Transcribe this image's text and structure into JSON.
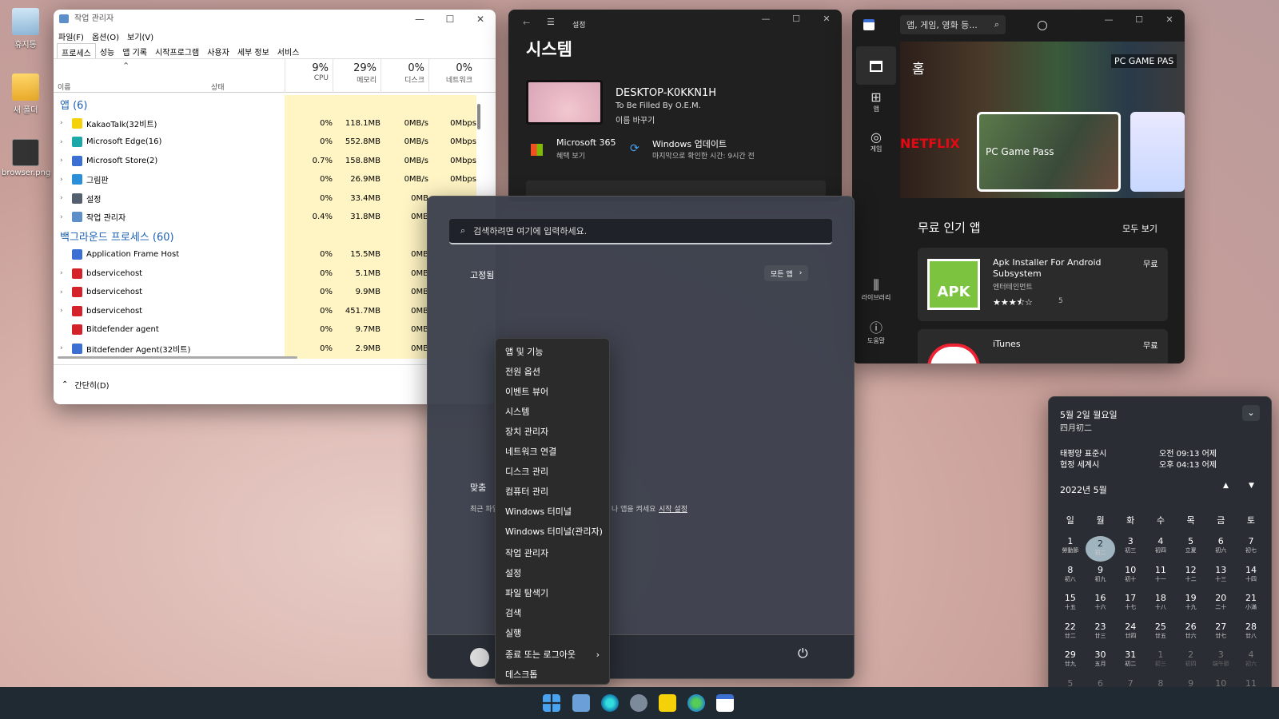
{
  "desktop": {
    "icons": [
      {
        "label": "휴지통"
      },
      {
        "label": "새 폴더"
      },
      {
        "label": "browser.png"
      }
    ]
  },
  "taskmgr": {
    "title": "작업 관리자",
    "menu": [
      "파일(F)",
      "옵션(O)",
      "보기(V)"
    ],
    "tabs": [
      "프로세스",
      "성능",
      "앱 기록",
      "시작프로그램",
      "사용자",
      "세부 정보",
      "서비스"
    ],
    "cols": {
      "name": "이름",
      "status": "상태",
      "cpu": {
        "pct": "9%",
        "label": "CPU"
      },
      "mem": {
        "pct": "29%",
        "label": "메모리"
      },
      "disk": {
        "pct": "0%",
        "label": "디스크"
      },
      "net": {
        "pct": "0%",
        "label": "네트워크"
      }
    },
    "apps_group": "앱 (6)",
    "bg_group": "백그라운드 프로세스 (60)",
    "apps": [
      {
        "name": "KakaoTalk(32비트)",
        "cpu": "0%",
        "mem": "118.1MB",
        "disk": "0MB/s",
        "net": "0Mbps",
        "color": "#f5d10a"
      },
      {
        "name": "Microsoft Edge(16)",
        "cpu": "0%",
        "mem": "552.8MB",
        "disk": "0MB/s",
        "net": "0Mbps",
        "color": "#1ca7a8"
      },
      {
        "name": "Microsoft Store(2)",
        "cpu": "0.7%",
        "mem": "158.8MB",
        "disk": "0MB/s",
        "net": "0Mbps",
        "color": "#3b6fd1"
      },
      {
        "name": "그림판",
        "cpu": "0%",
        "mem": "26.9MB",
        "disk": "0MB/s",
        "net": "0Mbps",
        "color": "#2a8fd8"
      },
      {
        "name": "설정",
        "cpu": "0%",
        "mem": "33.4MB",
        "disk": "0MB",
        "net": "",
        "color": "#55606e"
      },
      {
        "name": "작업 관리자",
        "cpu": "0.4%",
        "mem": "31.8MB",
        "disk": "0MB",
        "net": "",
        "color": "#5d8fc8"
      }
    ],
    "bg": [
      {
        "name": "Application Frame Host",
        "cpu": "0%",
        "mem": "15.5MB",
        "disk": "0MB",
        "color": "#3b6fd1",
        "arrow": ""
      },
      {
        "name": "bdservicehost",
        "cpu": "0%",
        "mem": "5.1MB",
        "disk": "0MB",
        "color": "#d3222a",
        "arrow": "›"
      },
      {
        "name": "bdservicehost",
        "cpu": "0%",
        "mem": "9.9MB",
        "disk": "0MB",
        "color": "#d3222a",
        "arrow": "›"
      },
      {
        "name": "bdservicehost",
        "cpu": "0%",
        "mem": "451.7MB",
        "disk": "0MB",
        "color": "#d3222a",
        "arrow": "›"
      },
      {
        "name": "Bitdefender agent",
        "cpu": "0%",
        "mem": "9.7MB",
        "disk": "0MB",
        "color": "#d3222a",
        "arrow": ""
      },
      {
        "name": "Bitdefender Agent(32비트)",
        "cpu": "0%",
        "mem": "2.9MB",
        "disk": "0MB",
        "color": "#3b6fd1",
        "arrow": "›"
      }
    ],
    "footer": "간단히(D)"
  },
  "settings": {
    "title": "설정",
    "heading": "시스템",
    "device": "DESKTOP-K0KKN1H",
    "oem": "To Be Filled By O.E.M.",
    "rename": "이름 바꾸기",
    "m365": "Microsoft 365",
    "m365_sub": "혜택 보기",
    "wu": "Windows 업데이트",
    "wu_sub": "마지막으로 확인한 시간: 9시간 전"
  },
  "store": {
    "search_placeholder": "앱, 게임, 영화 등...",
    "home": "홈",
    "nav": [
      "앱",
      "게임",
      "라이브러리",
      "도움말"
    ],
    "banner": "PC Game Pass",
    "banner_top": "PC GAME PAS",
    "netflix": "NETFLIX",
    "section": "무료 인기 앱",
    "see_all": "모두 보기",
    "app1": {
      "name": "Apk Installer For Android Subsystem",
      "cat": "엔터테인먼트",
      "price": "무료",
      "rating": "★★★⯪☆",
      "count": "5",
      "icon": "APK"
    },
    "app2": {
      "name": "iTunes",
      "price": "무료"
    }
  },
  "start": {
    "search_placeholder": "검색하려면 여기에 입력하세요.",
    "pinned": "고정됨",
    "all_apps": "모든 앱",
    "rec": "맞춤",
    "rec_text": "최근 파일",
    "rec_text2": "나 앱을 켜세요",
    "rec_link": "시작 설정"
  },
  "context": {
    "items": [
      "앱 및 기능",
      "전원 옵션",
      "이벤트 뷰어",
      "시스템",
      "장치 관리자",
      "네트워크 연결",
      "디스크 관리",
      "컴퓨터 관리",
      "Windows 터미널",
      "Windows 터미널(관리자)",
      "작업 관리자",
      "설정",
      "파일 탐색기",
      "검색",
      "실행",
      "종료 또는 로그아웃",
      "데스크톱"
    ]
  },
  "calendar": {
    "date": "5월 2일 월요일",
    "lunar": "四月初二",
    "tz1": "태평양 표준시",
    "tz1_time": "오전 09:13 어제",
    "tz2": "협정 세계시",
    "tz2_time": "오후 04:13 어제",
    "month": "2022년 5월",
    "weekdays": [
      "일",
      "월",
      "화",
      "수",
      "목",
      "금",
      "토"
    ],
    "weeks": [
      [
        [
          "1",
          "勞動節"
        ],
        [
          "2",
          "初二"
        ],
        [
          "3",
          "初三"
        ],
        [
          "4",
          "初四"
        ],
        [
          "5",
          "立夏"
        ],
        [
          "6",
          "初六"
        ],
        [
          "7",
          "初七"
        ]
      ],
      [
        [
          "8",
          "初八"
        ],
        [
          "9",
          "初九"
        ],
        [
          "10",
          "初十"
        ],
        [
          "11",
          "十一"
        ],
        [
          "12",
          "十二"
        ],
        [
          "13",
          "十三"
        ],
        [
          "14",
          "十四"
        ]
      ],
      [
        [
          "15",
          "十五"
        ],
        [
          "16",
          "十六"
        ],
        [
          "17",
          "十七"
        ],
        [
          "18",
          "十八"
        ],
        [
          "19",
          "十九"
        ],
        [
          "20",
          "二十"
        ],
        [
          "21",
          "小滿"
        ]
      ],
      [
        [
          "22",
          "廿二"
        ],
        [
          "23",
          "廿三"
        ],
        [
          "24",
          "廿四"
        ],
        [
          "25",
          "廿五"
        ],
        [
          "26",
          "廿六"
        ],
        [
          "27",
          "廿七"
        ],
        [
          "28",
          "廿八"
        ]
      ],
      [
        [
          "29",
          "廿九"
        ],
        [
          "30",
          "五月"
        ],
        [
          "31",
          "初二"
        ],
        [
          "1",
          "初三"
        ],
        [
          "2",
          "初四"
        ],
        [
          "3",
          "端午節"
        ],
        [
          "4",
          "初六"
        ]
      ],
      [
        [
          "5",
          "初七"
        ],
        [
          "6",
          "芒種"
        ],
        [
          "7",
          "初九"
        ],
        [
          "8",
          "初十"
        ],
        [
          "9",
          "十一"
        ],
        [
          "10",
          "十二"
        ],
        [
          "11",
          "十三"
        ]
      ]
    ]
  }
}
